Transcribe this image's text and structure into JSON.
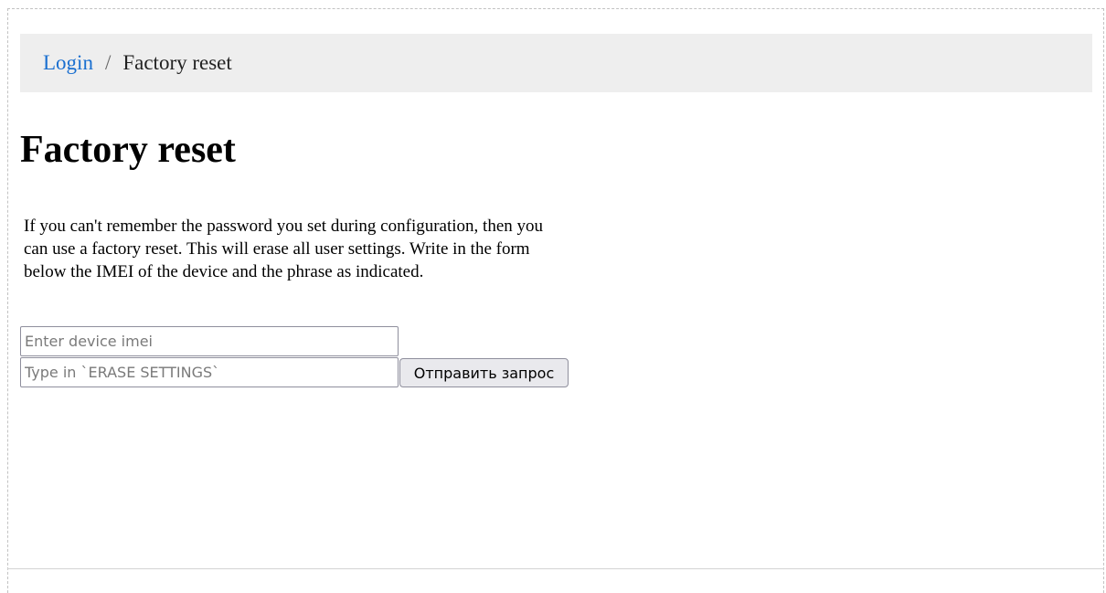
{
  "breadcrumb": {
    "items": [
      {
        "label": "Login"
      },
      {
        "label": "Factory reset"
      }
    ],
    "separator": "/"
  },
  "page": {
    "title": "Factory reset",
    "description": "If you can't remember the password you set during configuration, then you can use a factory reset. This will erase all user settings. Write in the form below the IMEI of the device and the phrase as indicated."
  },
  "form": {
    "imei_placeholder": "Enter device imei",
    "phrase_placeholder": "Type in `ERASE SETTINGS`",
    "submit_label": "Отправить запрос"
  },
  "colors": {
    "link": "#1a6fd0",
    "breadcrumb_background": "#eeeeee"
  }
}
